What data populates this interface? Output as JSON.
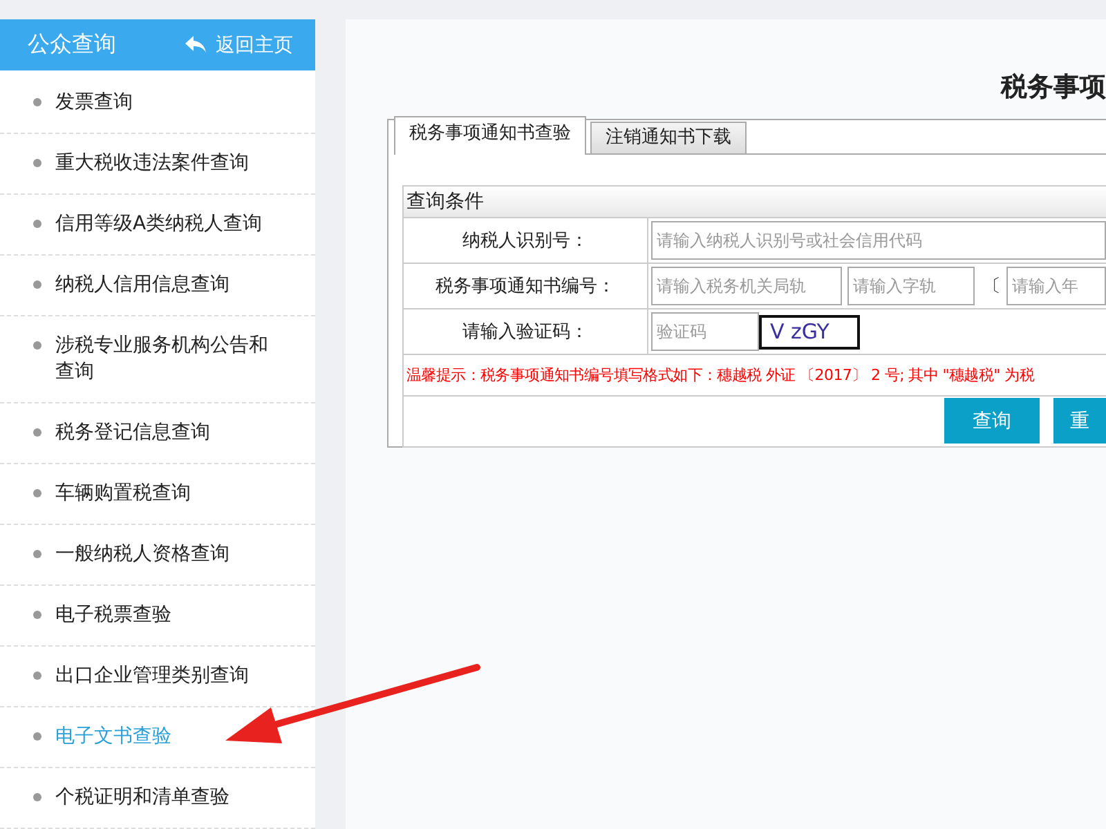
{
  "sidebar": {
    "title": "公众查询",
    "back_link": "返回主页",
    "items": [
      {
        "label": "发票查询",
        "selected": false
      },
      {
        "label": "重大税收违法案件查询",
        "selected": false
      },
      {
        "label": "信用等级A类纳税人查询",
        "selected": false
      },
      {
        "label": "纳税人信用信息查询",
        "selected": false
      },
      {
        "label": "涉税专业服务机构公告和查询",
        "selected": false
      },
      {
        "label": "税务登记信息查询",
        "selected": false
      },
      {
        "label": "车辆购置税查询",
        "selected": false
      },
      {
        "label": "一般纳税人资格查询",
        "selected": false
      },
      {
        "label": "电子税票查验",
        "selected": false
      },
      {
        "label": "出口企业管理类别查询",
        "selected": false
      },
      {
        "label": "电子文书查验",
        "selected": true
      },
      {
        "label": "个税证明和清单查验",
        "selected": false
      }
    ]
  },
  "main": {
    "title": "税务事项",
    "tabs": [
      {
        "label": "税务事项通知书查验",
        "selected": true
      },
      {
        "label": "注销通知书下载",
        "selected": false
      }
    ],
    "form": {
      "section_title": "查询条件",
      "rows": [
        {
          "label": "纳税人识别号：",
          "fields": [
            {
              "kind": "input",
              "placeholder": "请输入纳税人识别号或社会信用代码"
            }
          ]
        },
        {
          "label": "税务事项通知书编号：",
          "fields": [
            {
              "kind": "input",
              "placeholder": "请输入税务机关局轨"
            },
            {
              "kind": "input",
              "placeholder": "请输入字轨"
            },
            {
              "kind": "text",
              "text": "〔"
            },
            {
              "kind": "input",
              "placeholder": "请输入年"
            }
          ]
        },
        {
          "label": "请输入验证码：",
          "fields": [
            {
              "kind": "input",
              "placeholder": "验证码"
            },
            {
              "kind": "captcha",
              "text": "V zGY"
            }
          ]
        }
      ],
      "hint": "温馨提示：税务事项通知书编号填写格式如下：穗越税 外证 〔2017〕 2 号; 其中 \"穗越税\" 为税",
      "buttons": [
        "查询",
        "重"
      ]
    }
  }
}
